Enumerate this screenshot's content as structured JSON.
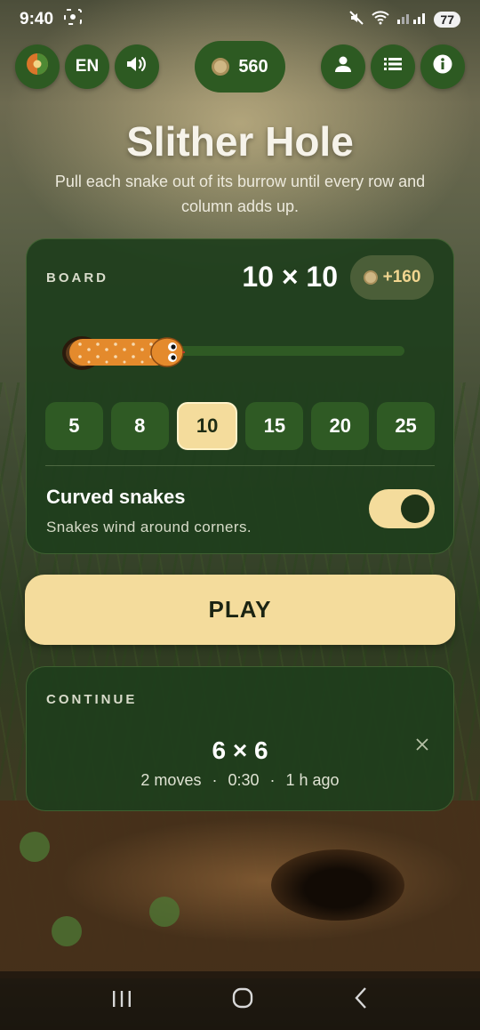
{
  "status_bar": {
    "time": "9:40",
    "battery": "77"
  },
  "top_bar": {
    "language": "EN",
    "coins": "560"
  },
  "header": {
    "title": "Slither Hole",
    "subtitle": "Pull each snake out of its burrow until every row and column adds up."
  },
  "board": {
    "label": "BOARD",
    "size_readout": "10 × 10",
    "bonus": "+160",
    "sizes": [
      "5",
      "8",
      "10",
      "15",
      "20",
      "25"
    ],
    "selected_size": "10",
    "option": {
      "title": "Curved snakes",
      "description": "Snakes wind around corners.",
      "enabled": true
    }
  },
  "play_label": "PLAY",
  "continue": {
    "label": "CONTINUE",
    "size": "6 × 6",
    "moves": "2 moves",
    "time": "0:30",
    "ago": "1 h ago",
    "separator": "·"
  },
  "colors": {
    "accent": "#f4dc9c",
    "panel": "#1e3e1c",
    "button": "#2d5a22"
  },
  "icons": {
    "status_left": "screenshot-icon",
    "top_left": "theme-icon",
    "sound": "speaker-icon",
    "profile": "person-icon",
    "list": "list-icon",
    "info": "info-icon"
  }
}
